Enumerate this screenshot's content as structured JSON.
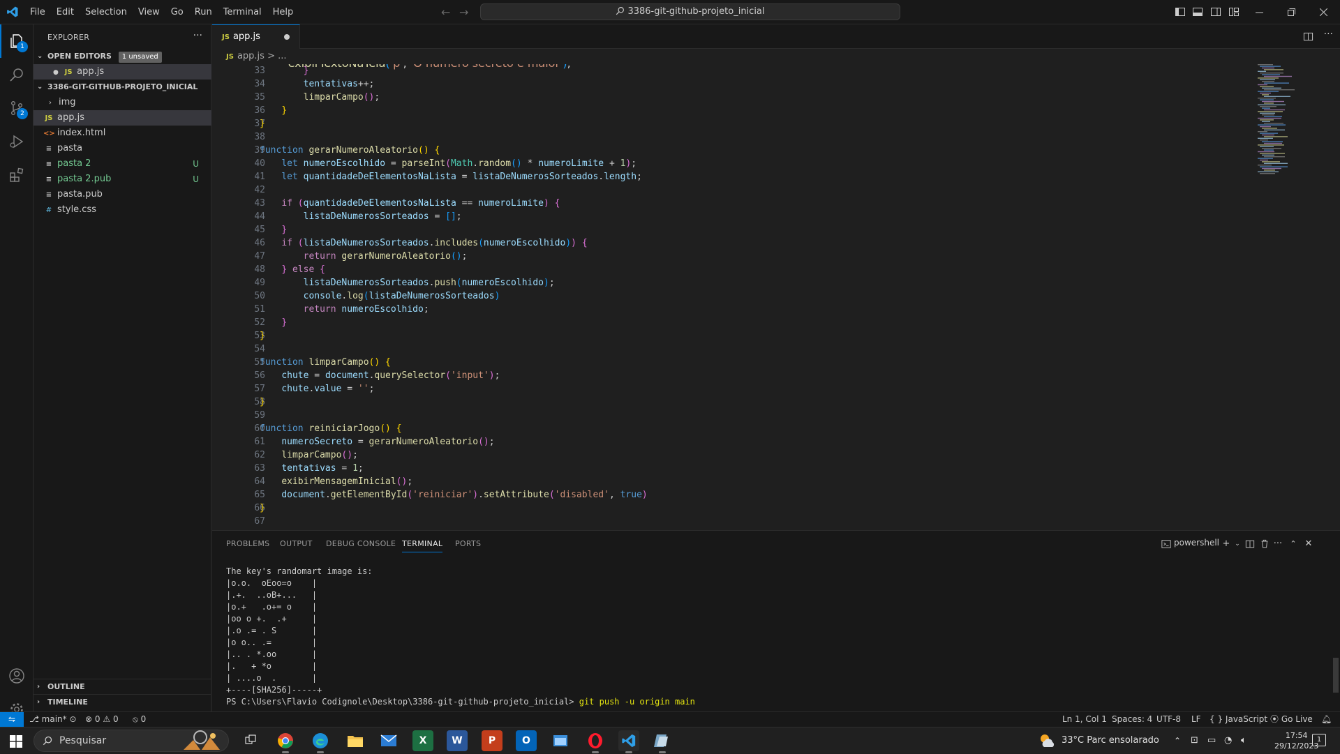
{
  "titlebar": {
    "menu": [
      "File",
      "Edit",
      "Selection",
      "View",
      "Go",
      "Run",
      "Terminal",
      "Help"
    ],
    "search_text": "3386-git-github-projeto_inicial"
  },
  "activity": {
    "explorer_badge": "1",
    "scm_badge": "2"
  },
  "sidebar": {
    "title": "EXPLORER",
    "open_editors": {
      "label": "OPEN EDITORS",
      "unsaved": "1 unsaved",
      "files": [
        "app.js"
      ]
    },
    "project": {
      "label": "3386-GIT-GITHUB-PROJETO_INICIAL",
      "items": [
        {
          "name": "img",
          "kind": "folder",
          "status": ""
        },
        {
          "name": "app.js",
          "kind": "js",
          "status": ""
        },
        {
          "name": "index.html",
          "kind": "html",
          "status": ""
        },
        {
          "name": "pasta",
          "kind": "txt",
          "status": ""
        },
        {
          "name": "pasta 2",
          "kind": "txt",
          "status": "U"
        },
        {
          "name": "pasta 2.pub",
          "kind": "txt",
          "status": "U"
        },
        {
          "name": "pasta.pub",
          "kind": "txt",
          "status": ""
        },
        {
          "name": "style.css",
          "kind": "css",
          "status": ""
        }
      ]
    },
    "outline": "OUTLINE",
    "timeline": "TIMELINE"
  },
  "editor": {
    "tab": "app.js",
    "breadcrumb_file": "app.js",
    "breadcrumb_rest": "> ...",
    "lines": [
      {
        "n": 33,
        "code": "        }"
      },
      {
        "n": 34,
        "code": "        tentativas++;"
      },
      {
        "n": 35,
        "code": "        limparCampo();"
      },
      {
        "n": 36,
        "code": "    }"
      },
      {
        "n": 37,
        "code": "}"
      },
      {
        "n": 38,
        "code": ""
      },
      {
        "n": 39,
        "code": "function gerarNumeroAleatorio() {"
      },
      {
        "n": 40,
        "code": "    let numeroEscolhido = parseInt(Math.random() * numeroLimite + 1);"
      },
      {
        "n": 41,
        "code": "    let quantidadeDeElementosNaLista = listaDeNumerosSorteados.length;"
      },
      {
        "n": 42,
        "code": ""
      },
      {
        "n": 43,
        "code": "    if (quantidadeDeElementosNaLista == numeroLimite) {"
      },
      {
        "n": 44,
        "code": "        listaDeNumerosSorteados = [];"
      },
      {
        "n": 45,
        "code": "    }"
      },
      {
        "n": 46,
        "code": "    if (listaDeNumerosSorteados.includes(numeroEscolhido)) {"
      },
      {
        "n": 47,
        "code": "        return gerarNumeroAleatorio();"
      },
      {
        "n": 48,
        "code": "    } else {"
      },
      {
        "n": 49,
        "code": "        listaDeNumerosSorteados.push(numeroEscolhido);"
      },
      {
        "n": 50,
        "code": "        console.log(listaDeNumerosSorteados)"
      },
      {
        "n": 51,
        "code": "        return numeroEscolhido;"
      },
      {
        "n": 52,
        "code": "    }"
      },
      {
        "n": 53,
        "code": "}"
      },
      {
        "n": 54,
        "code": ""
      },
      {
        "n": 55,
        "code": "function limparCampo() {"
      },
      {
        "n": 56,
        "code": "    chute = document.querySelector('input');"
      },
      {
        "n": 57,
        "code": "    chute.value = '';"
      },
      {
        "n": 58,
        "code": "}"
      },
      {
        "n": 59,
        "code": ""
      },
      {
        "n": 60,
        "code": "function reiniciarJogo() {"
      },
      {
        "n": 61,
        "code": "    numeroSecreto = gerarNumeroAleatorio();"
      },
      {
        "n": 62,
        "code": "    limparCampo();"
      },
      {
        "n": 63,
        "code": "    tentativas = 1;"
      },
      {
        "n": 64,
        "code": "    exibirMensagemInicial();"
      },
      {
        "n": 65,
        "code": "    document.getElementById('reiniciar').setAttribute('disabled', true)"
      },
      {
        "n": 66,
        "code": "}"
      },
      {
        "n": 67,
        "code": ""
      }
    ]
  },
  "panel": {
    "tabs": [
      "PROBLEMS",
      "OUTPUT",
      "DEBUG CONSOLE",
      "TERMINAL",
      "PORTS"
    ],
    "shell": "powershell",
    "terminal_lines": [
      "The key's randomart image is:",
      "|o.o.  oEoo=o    |",
      "|.+.  ..oB+...   |",
      "|o.+   .o+= o    |",
      "|oo o +.  .+     |",
      "|.o .= . S       |",
      "|o o.. .=        |",
      "|.. . *.oo       |",
      "|.   + *o        |",
      "| ....o  .       |",
      "+----[SHA256]-----+"
    ],
    "prompt": "PS C:\\Users\\Flavio Codignole\\Desktop\\3386-git-github-projeto_inicial> ",
    "command": "git push -u origin main"
  },
  "statusbar": {
    "branch": "main*",
    "errors": "0",
    "warnings": "0",
    "ports": "0",
    "position": "Ln 1, Col 1",
    "spaces": "Spaces: 4",
    "encoding": "UTF-8",
    "eol": "LF",
    "language": "JavaScript",
    "golive": "Go Live"
  },
  "taskbar": {
    "search": "Pesquisar",
    "weather": "33°C  Parc ensolarado",
    "time": "17:54",
    "date": "29/12/2023",
    "notifications": "1"
  },
  "colors": {
    "accent": "#0078d4",
    "background": "#1f1f1f",
    "sidebar": "#181818"
  }
}
